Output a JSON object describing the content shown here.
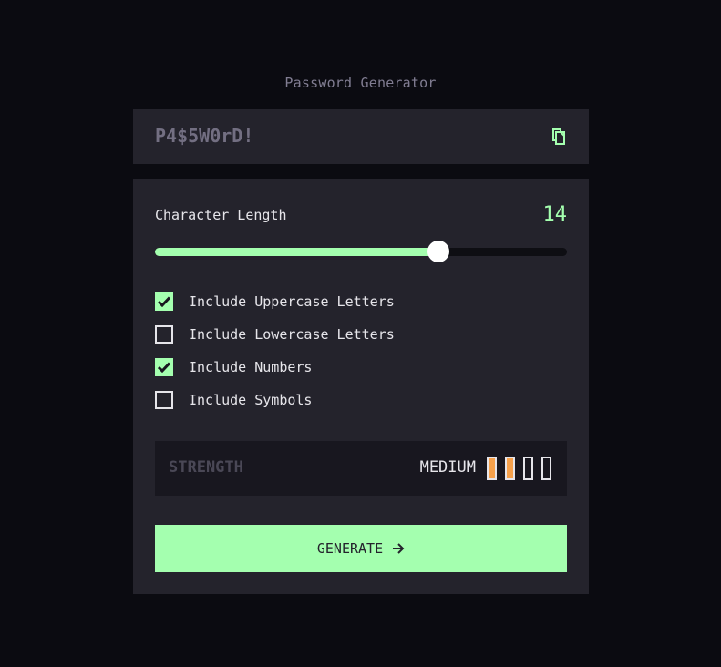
{
  "title": "Password Generator",
  "output": {
    "password": "P4$5W0rD!",
    "copy_icon": "copy-icon"
  },
  "length": {
    "label": "Character Length",
    "value": "14",
    "fraction": 0.6881
  },
  "options": [
    {
      "label": "Include Uppercase Letters",
      "checked": true
    },
    {
      "label": "Include Lowercase Letters",
      "checked": false
    },
    {
      "label": "Include Numbers",
      "checked": true
    },
    {
      "label": "Include Symbols",
      "checked": false
    }
  ],
  "strength": {
    "label": "STRENGTH",
    "value": "MEDIUM",
    "level": 2,
    "max": 4,
    "color": "#f6a14b"
  },
  "generate": {
    "label": "GENERATE",
    "icon": "arrow-right-icon"
  },
  "colors": {
    "accent": "#a4ffaf",
    "background": "#0b0b11",
    "panel": "#24232c"
  }
}
